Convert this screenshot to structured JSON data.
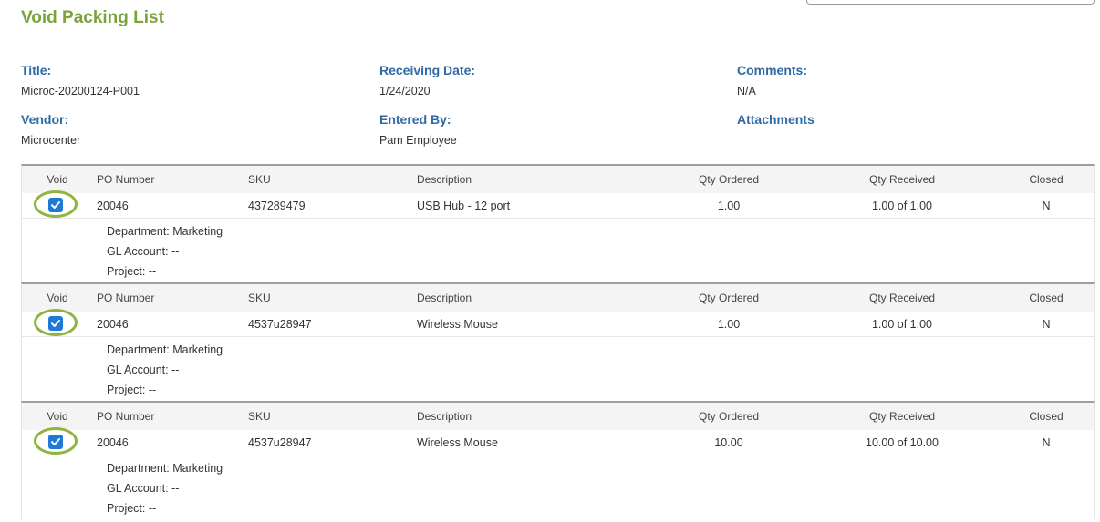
{
  "page_title": "Void Packing List",
  "fields": {
    "title_label": "Title:",
    "title_value": "Microc-20200124-P001",
    "vendor_label": "Vendor:",
    "vendor_value": "Microcenter",
    "receiving_date_label": "Receiving Date:",
    "receiving_date_value": "1/24/2020",
    "entered_by_label": "Entered By:",
    "entered_by_value": "Pam Employee",
    "comments_label": "Comments:",
    "comments_value": "N/A",
    "attachments_label": "Attachments"
  },
  "columns": {
    "void": "Void",
    "po_number": "PO Number",
    "sku": "SKU",
    "description": "Description",
    "qty_ordered": "Qty Ordered",
    "qty_received": "Qty Received",
    "closed": "Closed"
  },
  "lines": [
    {
      "void_checked": true,
      "po_number": "20046",
      "sku": "437289479",
      "description": "USB Hub - 12 port",
      "qty_ordered": "1.00",
      "qty_received": "1.00 of 1.00",
      "closed": "N",
      "department": "Department: Marketing",
      "gl_account": "GL Account: --",
      "project": "Project: --"
    },
    {
      "void_checked": true,
      "po_number": "20046",
      "sku": "4537u28947",
      "description": "Wireless Mouse",
      "qty_ordered": "1.00",
      "qty_received": "1.00 of 1.00",
      "closed": "N",
      "department": "Department: Marketing",
      "gl_account": "GL Account: --",
      "project": "Project: --"
    },
    {
      "void_checked": true,
      "po_number": "20046",
      "sku": "4537u28947",
      "description": "Wireless Mouse",
      "qty_ordered": "10.00",
      "qty_received": "10.00 of 10.00",
      "closed": "N",
      "department": "Department: Marketing",
      "gl_account": "GL Account: --",
      "project": "Project: --"
    }
  ],
  "colors": {
    "title_green": "#7aa43a",
    "label_blue": "#2f6aa6",
    "checkbox_blue": "#1f7ad6",
    "highlight_green": "#8db53f"
  }
}
